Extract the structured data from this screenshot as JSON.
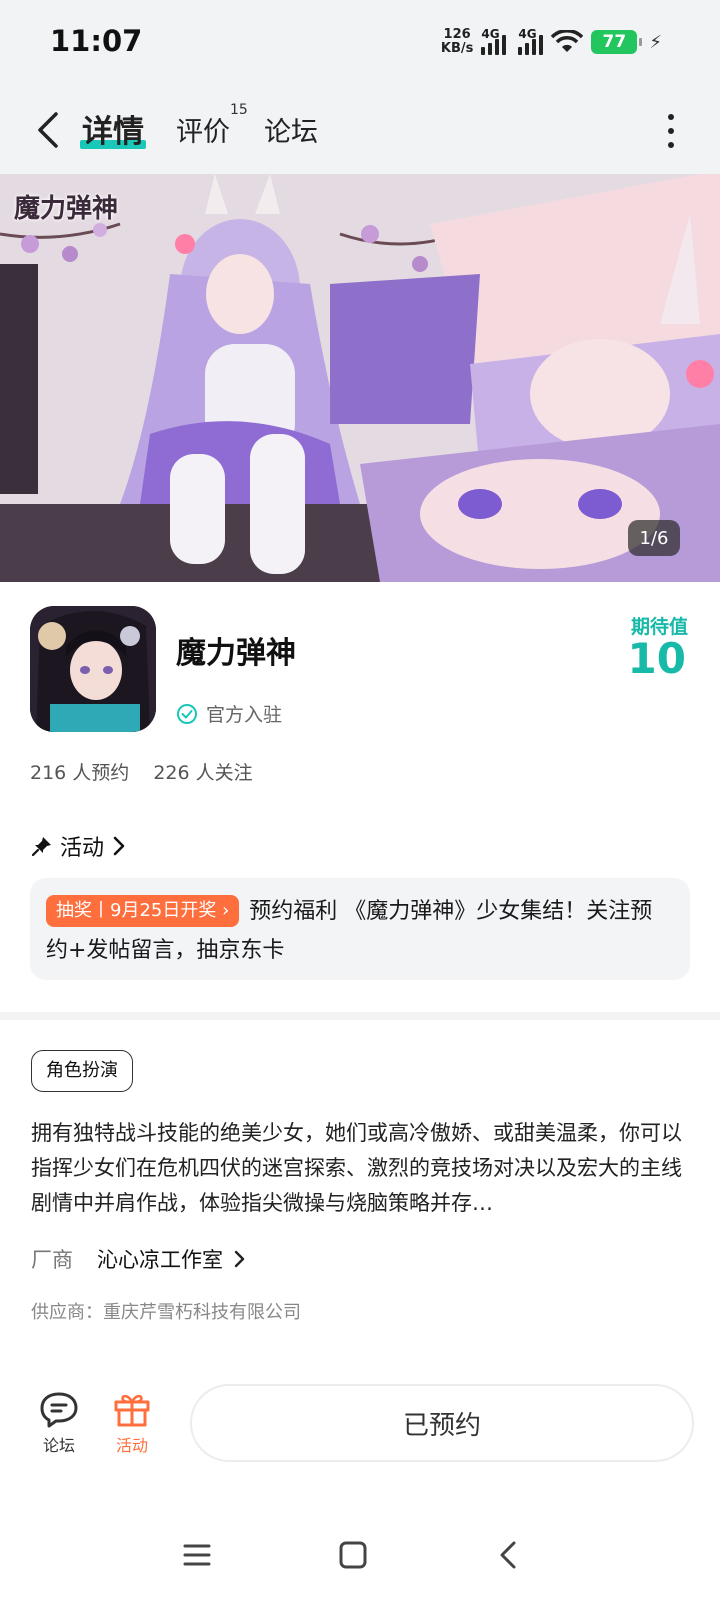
{
  "status_bar": {
    "time": "11:07",
    "net_speed_value": "126",
    "net_speed_unit": "KB/s",
    "signal_label_1": "4G",
    "signal_label_2": "4G",
    "battery": "77"
  },
  "nav": {
    "tabs": [
      {
        "label": "详情",
        "active": true
      },
      {
        "label": "评价",
        "badge": "15"
      },
      {
        "label": "论坛"
      }
    ]
  },
  "banner": {
    "logo_text": "魔力弹神",
    "counter": "1/6"
  },
  "game": {
    "title": "魔力弹神",
    "verified_text": "官方入驻",
    "expect_label": "期待值",
    "expect_value": "10",
    "reservations": "216 人预约",
    "followers": "226 人关注"
  },
  "activity": {
    "heading": "活动",
    "tag": "抽奖丨9月25日开奖",
    "text": "预约福利 《魔力弹神》少女集结！关注预约+发帖留言，抽京东卡"
  },
  "details": {
    "genre_tag": "角色扮演",
    "description": "拥有独特战斗技能的绝美少女，她们或高冷傲娇、或甜美温柔，你可以指挥少女们在危机四伏的迷宫探索、激烈的竞技场对决以及宏大的主线剧情中并肩作战，体验指尖微操与烧脑策略并存…",
    "vendor_label": "厂商",
    "vendor_name": "沁心凉工作室",
    "supplier": "供应商：重庆芹雪朽科技有限公司"
  },
  "bottom_bar": {
    "forum_label": "论坛",
    "activity_label": "活动",
    "reserve_label": "已预约"
  },
  "colors": {
    "accent": "#19c8b8",
    "expect": "#17b9a8",
    "orange": "#ff6f3d"
  }
}
